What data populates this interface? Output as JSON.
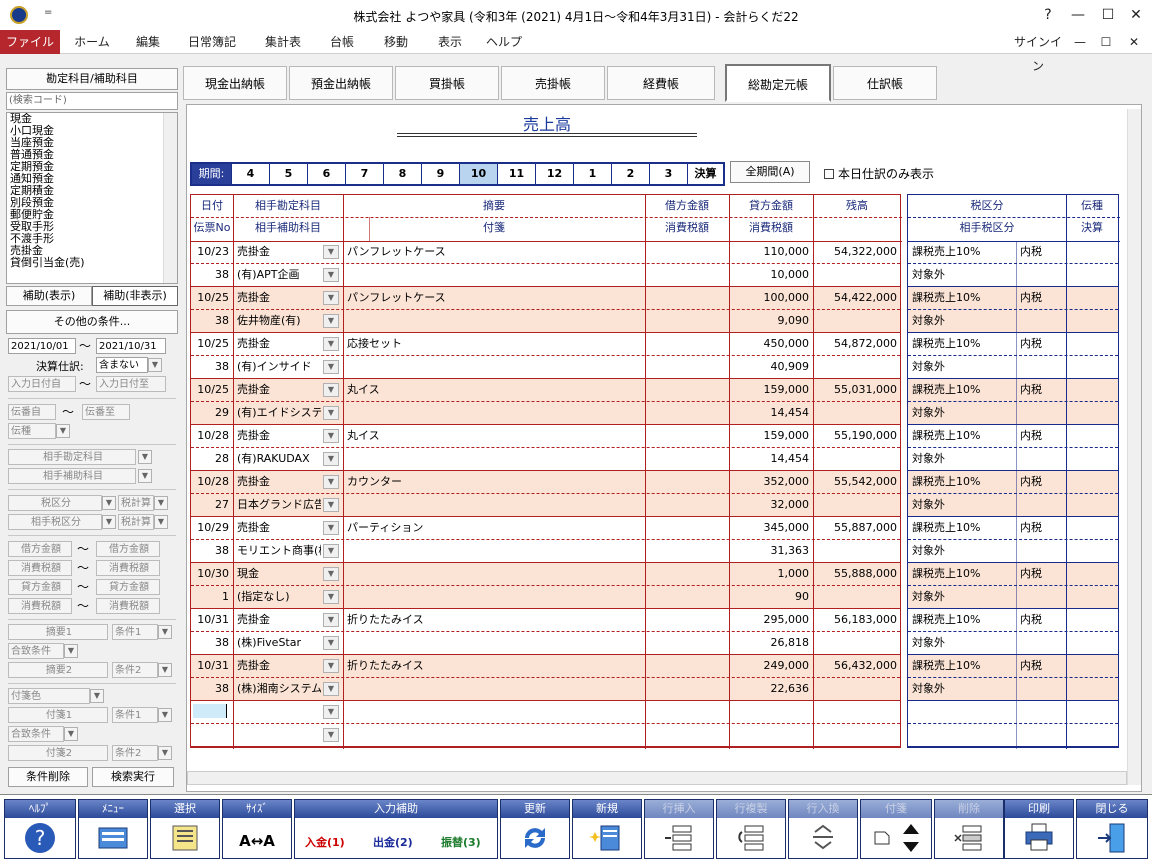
{
  "window": {
    "title": "株式会社 よつや家具 (令和3年 (2021) 4月1日～令和4年3月31日) - 会計らくだ22",
    "help": "?",
    "minimize": "—",
    "maximize": "☐",
    "close": "✕",
    "signin": "サインイン",
    "qa": "="
  },
  "menu": [
    "ファイル",
    "ホーム",
    "編集",
    "日常簿記",
    "集計表",
    "台帳",
    "移動",
    "表示",
    "ヘルプ"
  ],
  "left": {
    "header": "勘定科目/補助科目",
    "search_placeholder": "(検索コード)",
    "accounts": [
      "現金",
      "小口現金",
      "当座預金",
      "普通預金",
      "定期預金",
      "通知預金",
      "定期積金",
      "別段預金",
      "郵便貯金",
      "受取手形",
      "不渡手形",
      "売掛金",
      "貸倒引当金(売)"
    ],
    "show_sub": "補助(表示)",
    "hide_sub": "補助(非表示)",
    "other": "その他の条件...",
    "date_from": "2021/10/01",
    "date_to": "2021/10/31",
    "tilde": "～",
    "settle_label": "決算仕訳:",
    "settle_value": "含まない",
    "input_from": "入力日付自",
    "input_to": "入力日付至",
    "slip_from": "伝番自",
    "slip_to": "伝番至",
    "slip_type": "伝種",
    "partner_acc": "相手勘定科目",
    "partner_sub": "相手補助科目",
    "tax_div": "税区分",
    "tax_calc": "税計算",
    "partner_tax": "相手税区分",
    "tax_calc2": "税計算",
    "debit_amt": "借方金額",
    "debit_tax": "消費税額",
    "credit_amt": "貸方金額",
    "credit_tax": "消費税額",
    "memo1": "摘要1",
    "cond1": "条件1",
    "match": "合致条件",
    "memo2": "摘要2",
    "cond2": "条件2",
    "tag_color": "付箋色",
    "tag1": "付箋1",
    "tcond1": "条件1",
    "tmatch": "合致条件",
    "tag2": "付箋2",
    "tcond2": "条件2",
    "clear": "条件削除",
    "search": "検索実行"
  },
  "tabs": [
    "現金出納帳",
    "預金出納帳",
    "買掛帳",
    "売掛帳",
    "経費帳",
    "総勘定元帳",
    "仕訳帳"
  ],
  "ledger": {
    "title": "売上高",
    "period_label": "期間:",
    "months": [
      "4",
      "5",
      "6",
      "7",
      "8",
      "9",
      "10",
      "11",
      "12",
      "1",
      "2",
      "3",
      "決算"
    ],
    "all_period": "全期間(A)",
    "today_only": "本日仕訳のみ表示",
    "headers": {
      "date": "日付",
      "slip": "伝票No",
      "partner": "相手勘定科目",
      "partner_sub": "相手補助科目",
      "memo": "摘要",
      "tag": "付箋",
      "debit": "借方金額",
      "debit_tax": "消費税額",
      "credit": "貸方金額",
      "credit_tax": "消費税額",
      "balance": "残高",
      "taxdiv": "税区分",
      "ptaxdiv": "相手税区分",
      "type": "伝種",
      "settle": "決算"
    },
    "rows": [
      {
        "date": "10/23",
        "slip": "38",
        "acc": "売掛金",
        "sub": "(有)APT企画",
        "memo": "パンフレットケース",
        "credit": "110,000",
        "ctax": "10,000",
        "balance": "54,322,000",
        "tax": "課税売上10%",
        "inc": "内税",
        "ptax": "対象外"
      },
      {
        "date": "10/25",
        "slip": "38",
        "acc": "売掛金",
        "sub": "佐井物産(有)",
        "memo": "パンフレットケース",
        "credit": "100,000",
        "ctax": "9,090",
        "balance": "54,422,000",
        "tax": "課税売上10%",
        "inc": "内税",
        "ptax": "対象外"
      },
      {
        "date": "10/25",
        "slip": "38",
        "acc": "売掛金",
        "sub": "(有)インサイド",
        "memo": "応接セット",
        "credit": "450,000",
        "ctax": "40,909",
        "balance": "54,872,000",
        "tax": "課税売上10%",
        "inc": "内税",
        "ptax": "対象外"
      },
      {
        "date": "10/25",
        "slip": "29",
        "acc": "売掛金",
        "sub": "(有)エイドシステム",
        "memo": "丸イス",
        "credit": "159,000",
        "ctax": "14,454",
        "balance": "55,031,000",
        "tax": "課税売上10%",
        "inc": "内税",
        "ptax": "対象外"
      },
      {
        "date": "10/28",
        "slip": "28",
        "acc": "売掛金",
        "sub": "(有)RAKUDAX",
        "memo": "丸イス",
        "credit": "159,000",
        "ctax": "14,454",
        "balance": "55,190,000",
        "tax": "課税売上10%",
        "inc": "内税",
        "ptax": "対象外"
      },
      {
        "date": "10/28",
        "slip": "27",
        "acc": "売掛金",
        "sub": "日本グランド広告",
        "memo": "カウンター",
        "credit": "352,000",
        "ctax": "32,000",
        "balance": "55,542,000",
        "tax": "課税売上10%",
        "inc": "内税",
        "ptax": "対象外"
      },
      {
        "date": "10/29",
        "slip": "38",
        "acc": "売掛金",
        "sub": "モリエント商事(株)",
        "memo": "パーティション",
        "credit": "345,000",
        "ctax": "31,363",
        "balance": "55,887,000",
        "tax": "課税売上10%",
        "inc": "内税",
        "ptax": "対象外"
      },
      {
        "date": "10/30",
        "slip": "1",
        "acc": "現金",
        "sub": "(指定なし)",
        "memo": "",
        "credit": "1,000",
        "ctax": "90",
        "balance": "55,888,000",
        "tax": "課税売上10%",
        "inc": "内税",
        "ptax": "対象外"
      },
      {
        "date": "10/31",
        "slip": "38",
        "acc": "売掛金",
        "sub": "(株)FiveStar",
        "memo": "折りたたみイス",
        "credit": "295,000",
        "ctax": "26,818",
        "balance": "56,183,000",
        "tax": "課税売上10%",
        "inc": "内税",
        "ptax": "対象外"
      },
      {
        "date": "10/31",
        "slip": "38",
        "acc": "売掛金",
        "sub": "(株)湘南システム",
        "memo": "折りたたみイス",
        "credit": "249,000",
        "ctax": "22,636",
        "balance": "56,432,000",
        "tax": "課税売上10%",
        "inc": "内税",
        "ptax": "対象外"
      }
    ]
  },
  "toolbar": {
    "help": "ﾍﾙﾌﾟ",
    "menu": "ﾒﾆｭｰ",
    "select": "選択",
    "size": "ｻｲｽﾞ",
    "size_icon": "A↔A",
    "assist": "入力補助",
    "in": "入金(1)",
    "out": "出金(2)",
    "transfer": "振替(3)",
    "update": "更新",
    "new": "新規",
    "row_insert": "行挿入",
    "row_copy": "行複製",
    "row_swap": "行入換",
    "tag": "付箋",
    "delete": "削除",
    "print": "印刷",
    "close": "閉じる"
  },
  "colors": {
    "accent": "#b5272c",
    "alt_row": "#fbe4d6",
    "grid_red": "#b02020",
    "grid_blue": "#1a2a8a",
    "toolbar_blue": "#2c4a9a",
    "in": "#cc0000",
    "out": "#1a2a9a",
    "transfer": "#1a7a2a"
  }
}
